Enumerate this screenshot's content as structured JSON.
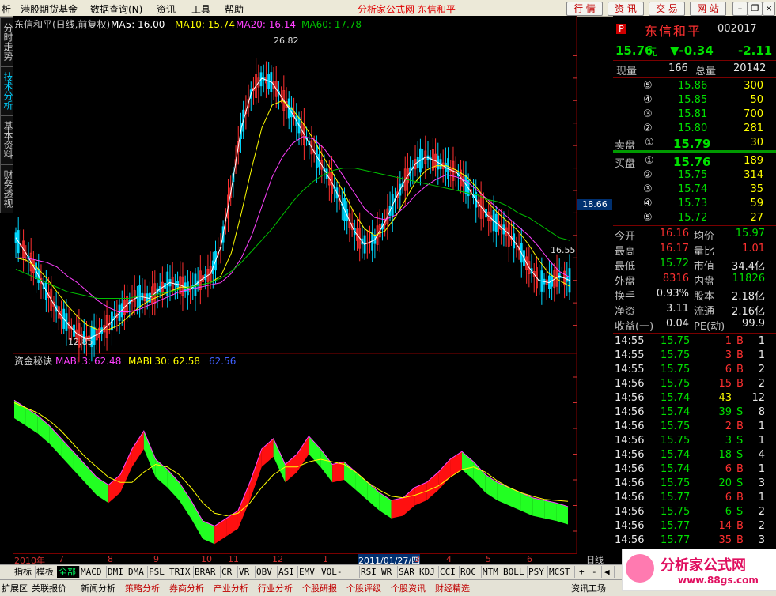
{
  "menu": {
    "items": [
      "析",
      "港股期货基金",
      "数据查询(N)",
      "资讯",
      "工具",
      "帮助"
    ],
    "center_title": "分析家公式网  东信和平",
    "buttons": [
      "行 情",
      "资 讯",
      "交 易",
      "网 站"
    ]
  },
  "side_tabs": [
    "分时走势",
    "技术分析",
    "基本资料",
    "财务透视"
  ],
  "main_chart": {
    "header": {
      "title": "东信和平(日线,前复权)",
      "ma5": "MA5: 16.00",
      "ma10": "MA10: 15.74",
      "ma20": "MA20: 16.14",
      "ma60": "MA60: 17.78"
    },
    "high_label": "26.82",
    "low_label": "12.85",
    "end_label": "16.55",
    "price_tag": "18.66"
  },
  "sub_chart": {
    "header": {
      "title": "资金秘诀",
      "mabl3": "MABL3: 62.48",
      "mabl30": "MABL30: 62.58",
      "val": "62.56"
    }
  },
  "chart_data": [
    {
      "type": "line",
      "title": "东信和平(日线,前复权)",
      "ylim": [
        13.0,
        27.0
      ],
      "y_ticks": [
        "26.00",
        "25.00",
        "24.00",
        "23.00",
        "22.00",
        "21.00",
        "20.00",
        "19.00",
        "18.00",
        "17.00",
        "16.00",
        "15.00",
        "14.00"
      ],
      "x_ticks": [
        "2010年",
        "7",
        "8",
        "9",
        "10",
        "11",
        "12",
        "1",
        "2011/01/27/四",
        "3",
        "4",
        "5",
        "6"
      ],
      "series": [
        {
          "name": "MA5",
          "values": [
            17.9,
            17.2,
            16.4,
            15.5,
            14.7,
            14.1,
            13.6,
            13.4,
            13.6,
            14.0,
            14.5,
            15.0,
            15.3,
            15.2,
            15.6,
            15.9,
            15.8,
            15.6,
            16.0,
            16.3,
            17.5,
            20.0,
            22.8,
            24.4,
            25.0,
            24.8,
            24.1,
            23.4,
            22.6,
            21.8,
            21.0,
            20.2,
            19.2,
            18.2,
            17.6,
            17.8,
            18.6,
            19.6,
            20.5,
            21.2,
            21.5,
            21.3,
            21.0,
            20.8,
            20.2,
            19.5,
            18.9,
            18.5,
            18.1,
            17.5,
            16.6,
            16.0,
            15.9,
            16.2,
            16.0
          ]
        },
        {
          "name": "MA10",
          "values": [
            17.0,
            16.9,
            16.6,
            16.1,
            15.5,
            14.9,
            14.4,
            14.0,
            13.8,
            13.8,
            14.0,
            14.4,
            14.8,
            15.1,
            15.3,
            15.5,
            15.7,
            15.7,
            15.8,
            15.9,
            16.2,
            17.2,
            19.0,
            21.0,
            22.8,
            23.8,
            24.0,
            23.6,
            23.0,
            22.3,
            21.5,
            20.7,
            19.9,
            19.0,
            18.3,
            18.0,
            18.2,
            18.8,
            19.6,
            20.4,
            20.9,
            21.1,
            21.1,
            20.9,
            20.6,
            20.1,
            19.5,
            19.0,
            18.6,
            18.2,
            17.6,
            16.9,
            16.3,
            16.0,
            15.74
          ]
        },
        {
          "name": "MA20",
          "values": [
            17.0,
            17.0,
            16.9,
            16.8,
            16.6,
            16.2,
            15.9,
            15.5,
            15.1,
            14.8,
            14.6,
            14.6,
            14.7,
            14.9,
            15.1,
            15.3,
            15.5,
            15.6,
            15.7,
            15.8,
            15.9,
            16.3,
            17.0,
            18.0,
            19.3,
            20.6,
            21.5,
            22.1,
            22.4,
            22.3,
            21.9,
            21.3,
            20.6,
            19.9,
            19.2,
            18.8,
            18.7,
            18.9,
            19.3,
            19.8,
            20.2,
            20.5,
            20.7,
            20.6,
            20.4,
            20.0,
            19.6,
            19.2,
            18.8,
            18.4,
            18.0,
            17.5,
            16.9,
            16.4,
            16.14
          ]
        },
        {
          "name": "MA60",
          "values": [
            16.5,
            16.3,
            16.1,
            15.9,
            15.7,
            15.5,
            15.4,
            15.3,
            15.2,
            15.2,
            15.2,
            15.2,
            15.3,
            15.3,
            15.4,
            15.5,
            15.6,
            15.7,
            15.8,
            15.9,
            16.1,
            16.4,
            16.8,
            17.3,
            17.8,
            18.3,
            18.9,
            19.5,
            20.0,
            20.4,
            20.7,
            20.9,
            21.0,
            21.0,
            20.9,
            20.8,
            20.7,
            20.6,
            20.5,
            20.4,
            20.3,
            20.2,
            20.1,
            20.0,
            19.9,
            19.8,
            19.6,
            19.5,
            19.3,
            19.0,
            18.8,
            18.5,
            18.2,
            17.9,
            17.78
          ]
        }
      ]
    },
    {
      "type": "area",
      "title": "资金秘诀",
      "ylim": [
        61.8,
        65.2
      ],
      "y_ticks": [
        "65.00",
        "64.50",
        "64.00",
        "63.50",
        "63.00",
        "62.50",
        "62.00"
      ],
      "series": [
        {
          "name": "MABL3",
          "values": [
            64.55,
            64.4,
            64.25,
            64.05,
            63.8,
            63.55,
            63.3,
            63.05,
            62.9,
            63.1,
            63.6,
            63.95,
            63.4,
            63.2,
            62.95,
            62.6,
            62.2,
            62.1,
            62.25,
            62.4,
            62.95,
            63.6,
            63.8,
            63.3,
            63.5,
            63.85,
            63.6,
            63.3,
            63.35,
            63.15,
            62.95,
            62.75,
            62.6,
            62.65,
            62.85,
            62.95,
            63.15,
            63.4,
            63.55,
            63.35,
            63.1,
            62.95,
            62.85,
            62.75,
            62.65,
            62.6,
            62.55,
            62.48
          ]
        },
        {
          "name": "MABL30",
          "values": [
            64.5,
            64.4,
            64.3,
            64.15,
            63.95,
            63.7,
            63.45,
            63.25,
            63.05,
            62.95,
            62.95,
            63.15,
            63.3,
            63.25,
            63.1,
            62.85,
            62.55,
            62.35,
            62.3,
            62.35,
            62.55,
            62.85,
            63.1,
            63.25,
            63.25,
            63.35,
            63.4,
            63.35,
            63.3,
            63.15,
            62.95,
            62.8,
            62.68,
            62.65,
            62.7,
            62.78,
            62.88,
            63.05,
            63.2,
            63.25,
            63.15,
            62.98,
            62.85,
            62.75,
            62.68,
            62.62,
            62.6,
            62.58
          ]
        }
      ]
    }
  ],
  "quote": {
    "badge": "P",
    "name": "东信和平",
    "code": "002017",
    "price": "15.76",
    "unit": "元",
    "change": "▼-0.34",
    "change_pct": "-2.11",
    "now_label": "现量",
    "now_val": "166",
    "total_label": "总量",
    "total_val": "20142",
    "asks": [
      {
        "lvl": "⑤",
        "price": "15.86",
        "vol": "300"
      },
      {
        "lvl": "④",
        "price": "15.85",
        "vol": "50"
      },
      {
        "lvl": "③",
        "price": "15.81",
        "vol": "700"
      },
      {
        "lvl": "②",
        "price": "15.80",
        "vol": "281"
      },
      {
        "lvl": "①",
        "price": "15.79",
        "vol": "30",
        "label": "卖盘"
      }
    ],
    "bids": [
      {
        "lvl": "①",
        "price": "15.76",
        "vol": "189",
        "label": "买盘"
      },
      {
        "lvl": "②",
        "price": "15.75",
        "vol": "314"
      },
      {
        "lvl": "③",
        "price": "15.74",
        "vol": "35"
      },
      {
        "lvl": "④",
        "price": "15.73",
        "vol": "59"
      },
      {
        "lvl": "⑤",
        "price": "15.72",
        "vol": "27"
      }
    ],
    "stats": [
      {
        "l1": "今开",
        "v1": "16.16",
        "l2": "均价",
        "v2": "15.97"
      },
      {
        "l1": "最高",
        "v1": "16.17",
        "l2": "量比",
        "v2": "1.01"
      },
      {
        "l1": "最低",
        "v1": "15.72",
        "l2": "市值",
        "v2": "34.4亿"
      },
      {
        "l1": "外盘",
        "v1": "8316",
        "l2": "内盘",
        "v2": "11826"
      },
      {
        "l1": "换手",
        "v1": "0.93%",
        "l2": "股本",
        "v2": "2.18亿"
      },
      {
        "l1": "净资",
        "v1": "3.11",
        "l2": "流通",
        "v2": "2.16亿"
      },
      {
        "l1": "收益(一)",
        "v1": "0.04",
        "l2": "PE(动)",
        "v2": "99.9"
      }
    ],
    "ticks": [
      {
        "t": "14:55",
        "p": "15.75",
        "v": "1",
        "s": "B",
        "n": "1"
      },
      {
        "t": "14:55",
        "p": "15.75",
        "v": "3",
        "s": "B",
        "n": "1"
      },
      {
        "t": "14:55",
        "p": "15.75",
        "v": "6",
        "s": "B",
        "n": "2"
      },
      {
        "t": "14:56",
        "p": "15.75",
        "v": "15",
        "s": "B",
        "n": "2"
      },
      {
        "t": "14:56",
        "p": "15.74",
        "v": "43",
        "s": "",
        "n": "12"
      },
      {
        "t": "14:56",
        "p": "15.74",
        "v": "39",
        "s": "S",
        "n": "8"
      },
      {
        "t": "14:56",
        "p": "15.75",
        "v": "2",
        "s": "B",
        "n": "1"
      },
      {
        "t": "14:56",
        "p": "15.75",
        "v": "3",
        "s": "S",
        "n": "1"
      },
      {
        "t": "14:56",
        "p": "15.74",
        "v": "18",
        "s": "S",
        "n": "4"
      },
      {
        "t": "14:56",
        "p": "15.74",
        "v": "6",
        "s": "B",
        "n": "1"
      },
      {
        "t": "14:56",
        "p": "15.75",
        "v": "20",
        "s": "S",
        "n": "3"
      },
      {
        "t": "14:56",
        "p": "15.77",
        "v": "6",
        "s": "B",
        "n": "1"
      },
      {
        "t": "14:56",
        "p": "15.75",
        "v": "6",
        "s": "S",
        "n": "2"
      },
      {
        "t": "14:56",
        "p": "15.77",
        "v": "14",
        "s": "B",
        "n": "2"
      },
      {
        "t": "14:56",
        "p": "15.77",
        "v": "35",
        "s": "B",
        "n": "3"
      }
    ]
  },
  "period_label": "日线",
  "bottom_tabs": [
    "指标",
    "模板",
    "全部",
    "MACD",
    "DMI",
    "DMA",
    "FSL",
    "TRIX",
    "BRAR",
    "CR",
    "VR",
    "OBV",
    "ASI",
    "EMV",
    "VOL-TDX",
    "RSI",
    "WR",
    "SAR",
    "KDJ",
    "CCI",
    "ROC",
    "MTM",
    "BOLL",
    "PSY",
    "MCST"
  ],
  "status_items": [
    "扩展区",
    "关联报价",
    "新闻分析",
    "策略分析",
    "券商分析",
    "产业分析",
    "行业分析",
    "个股研报",
    "个股评级",
    "个股资讯",
    "财经精选",
    "资讯工场"
  ],
  "watermark": "分析家公式网",
  "watermark_url": "www.88gs.com",
  "colors": {
    "up": "#ff3030",
    "down": "#00e000",
    "ma5": "#ffffff",
    "ma10": "#ffff00",
    "ma20": "#ff40ff",
    "ma60": "#00c000",
    "axis": "#d03030"
  }
}
